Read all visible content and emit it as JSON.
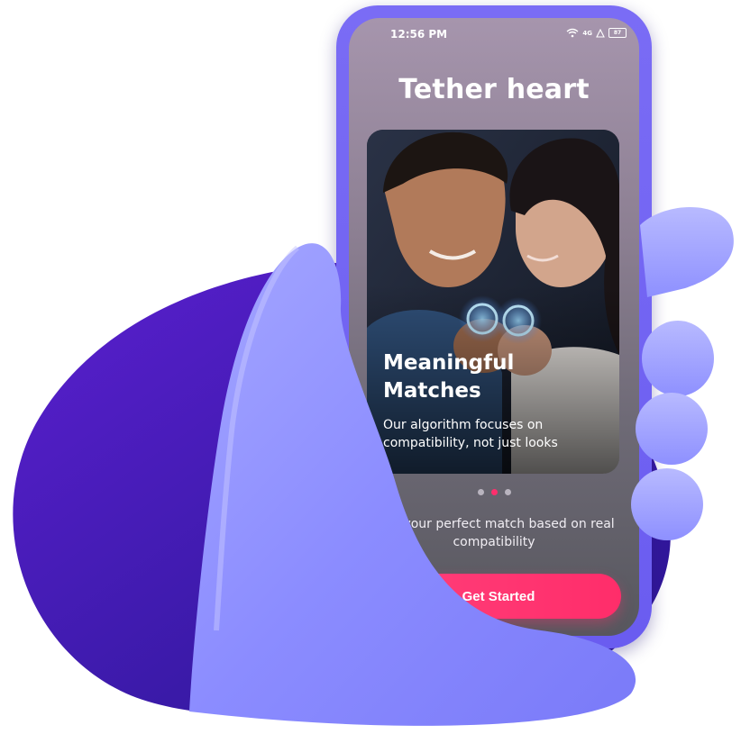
{
  "status_bar": {
    "time": "12:56 PM",
    "network": "4G",
    "battery": "87"
  },
  "app": {
    "title": "Tether heart"
  },
  "onboarding": {
    "slide_title": "Meaningful\nMatches",
    "slide_description": "Our algorithm focuses on compatibility, not just looks",
    "active_slide": 2,
    "total_slides": 3,
    "tagline": "Find your perfect match based on real compatibility",
    "cta_label": "Get Started"
  },
  "colors": {
    "accent": "#ff2f6d",
    "phone_frame": "#6f61f2",
    "blob": "#4a1fc4"
  },
  "icons": [
    "wifi-icon",
    "signal-icon",
    "warning-icon",
    "battery-icon"
  ]
}
